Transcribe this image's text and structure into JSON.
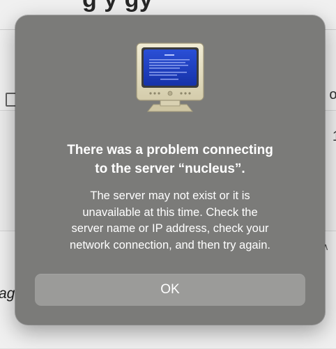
{
  "background": {
    "title_fragment": "g y  gy",
    "right_fragment_top": "ol",
    "right_fragment_mid": "1",
    "left_fragment": "ag"
  },
  "alert": {
    "icon": "crt-monitor-icon",
    "title_line1": "There was a problem connecting",
    "title_line2": "to the server “nucleus”.",
    "message_line1": "The server may not exist or it is",
    "message_line2": "unavailable at this time. Check the",
    "message_line3": "server name or IP address, check your",
    "message_line4": "network connection, and then try again.",
    "ok_label": "OK"
  },
  "colors": {
    "dialog_bg": "#7b7b79",
    "button_bg": "#9b9b99",
    "text": "#ffffff",
    "screen_blue": "#1e3fc0"
  }
}
